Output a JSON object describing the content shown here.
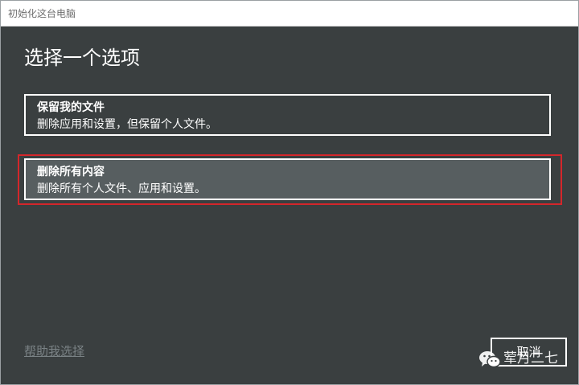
{
  "window": {
    "title": "初始化这台电脑"
  },
  "main": {
    "heading": "选择一个选项",
    "options": [
      {
        "title": "保留我的文件",
        "description": "删除应用和设置，但保留个人文件。"
      },
      {
        "title": "删除所有内容",
        "description": "删除所有个人文件、应用和设置。",
        "highlighted": true
      }
    ]
  },
  "footer": {
    "help_link": "帮助我选择",
    "cancel_label": "取消"
  },
  "watermark": {
    "text": "荤月二七",
    "icon": "wechat-icon"
  },
  "colors": {
    "background": "#3a3f40",
    "selected_option": "#575e60",
    "highlight_border": "#d4262b",
    "link": "#7a8285"
  }
}
